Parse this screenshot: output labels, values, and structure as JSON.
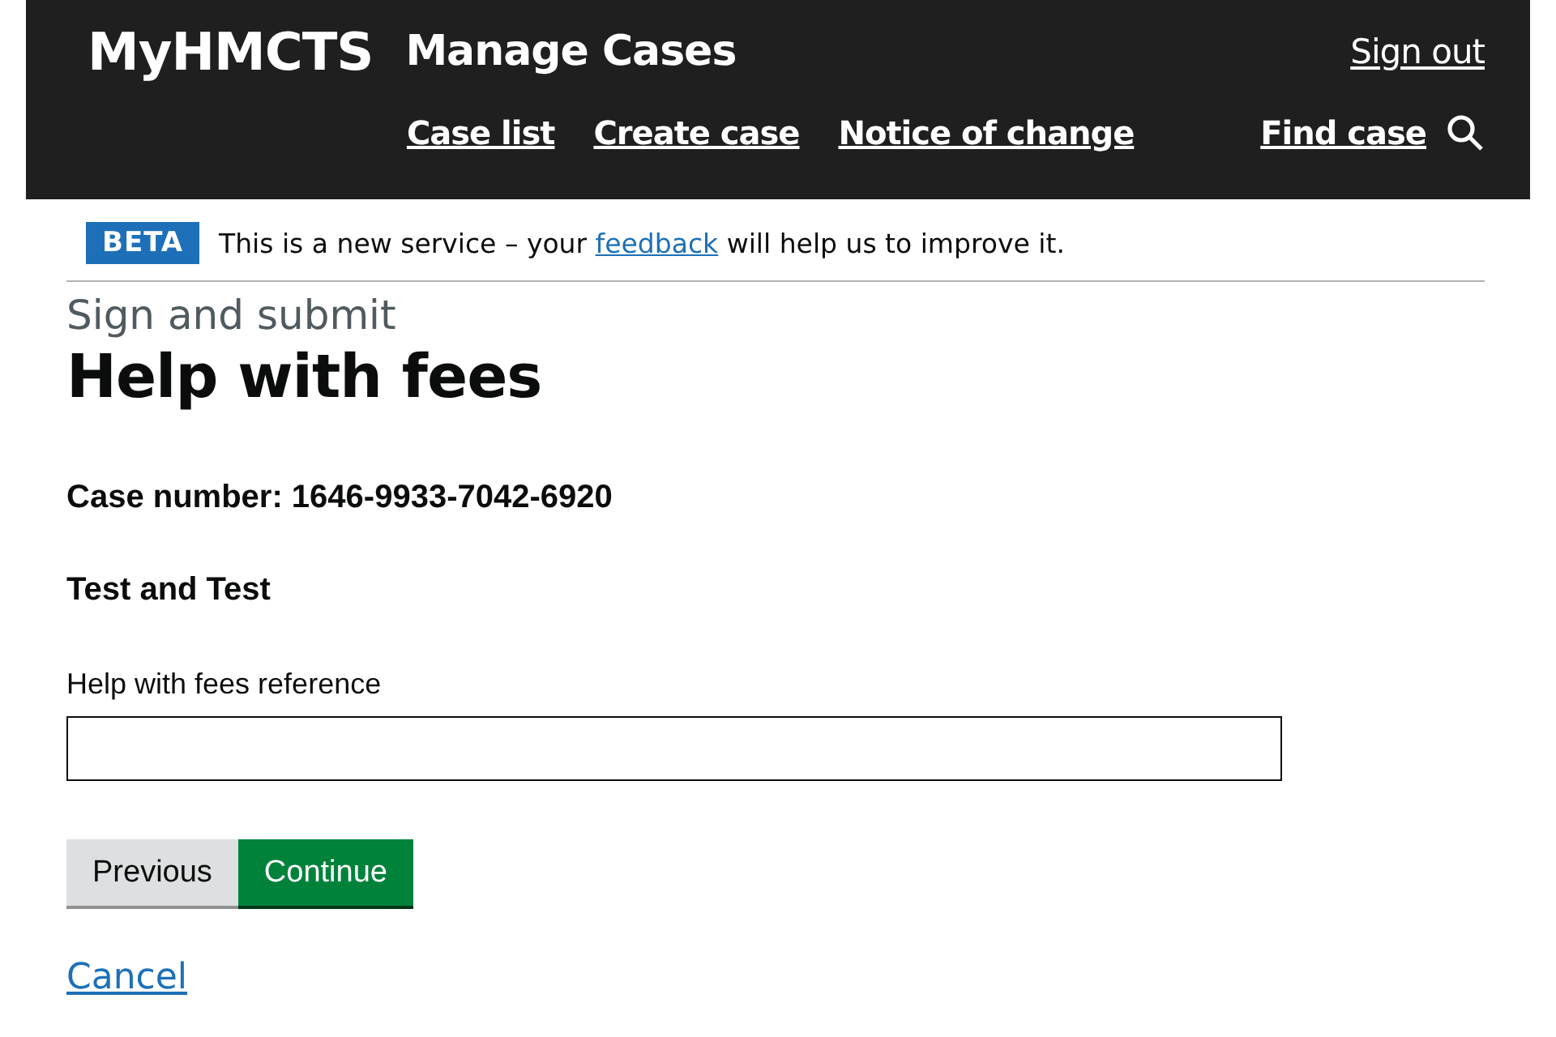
{
  "header": {
    "logo": "MyHMCTS",
    "service": "Manage Cases",
    "sign_out": "Sign out",
    "nav": [
      {
        "label": "Case list"
      },
      {
        "label": "Create case"
      },
      {
        "label": "Notice of change"
      }
    ],
    "find": "Find case"
  },
  "banner": {
    "tag": "BETA",
    "before": "This is a new service – your",
    "link": "feedback",
    "after": "will help us to improve it."
  },
  "caption": "Sign and submit",
  "title": "Help with fees",
  "case_number": "Case number: 1646-9933-7042-6920",
  "parties": "Test and Test",
  "field": {
    "label": "Help with fees reference"
  },
  "buttons": [
    {
      "label": "Previous",
      "kind": "secondary"
    },
    {
      "label": "Continue",
      "kind": "primary"
    }
  ],
  "cancel": "Cancel"
}
